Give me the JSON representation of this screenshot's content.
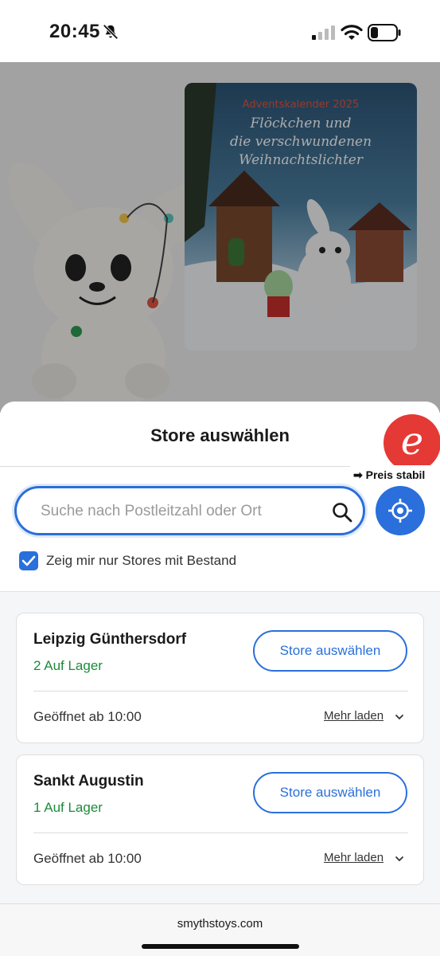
{
  "status_bar": {
    "time": "20:45",
    "icons": [
      "bell-slash-icon",
      "cellular-signal-icon",
      "wifi-icon",
      "battery-low-icon"
    ]
  },
  "hero": {
    "product_box_tag": "Adventskalender 2025",
    "product_box_title_lines": [
      "Flöckchen und",
      "die verschwundenen",
      "Weihnachtslichter"
    ]
  },
  "sheet": {
    "title": "Store auswählen",
    "extension_badge_letter": "e",
    "extension_label": "➡ Preis stabil",
    "search": {
      "placeholder": "Suche nach Postleitzahl oder Ort",
      "value": ""
    },
    "only_in_stock": {
      "checked": true,
      "label": "Zeig mir nur Stores mit Bestand"
    },
    "stores": [
      {
        "name": "Leipzig Günthersdorf",
        "stock": "2 Auf Lager",
        "select_label": "Store auswählen",
        "hours": "Geöffnet ab 10:00",
        "more_label": "Mehr laden"
      },
      {
        "name": "Sankt Augustin",
        "stock": "1 Auf Lager",
        "select_label": "Store auswählen",
        "hours": "Geöffnet ab 10:00",
        "more_label": "Mehr laden"
      }
    ]
  },
  "browser": {
    "url": "smythstoys.com"
  },
  "colors": {
    "accent_blue": "#2a6fdb",
    "stock_green": "#1e8a3c",
    "badge_red": "#e53935"
  }
}
